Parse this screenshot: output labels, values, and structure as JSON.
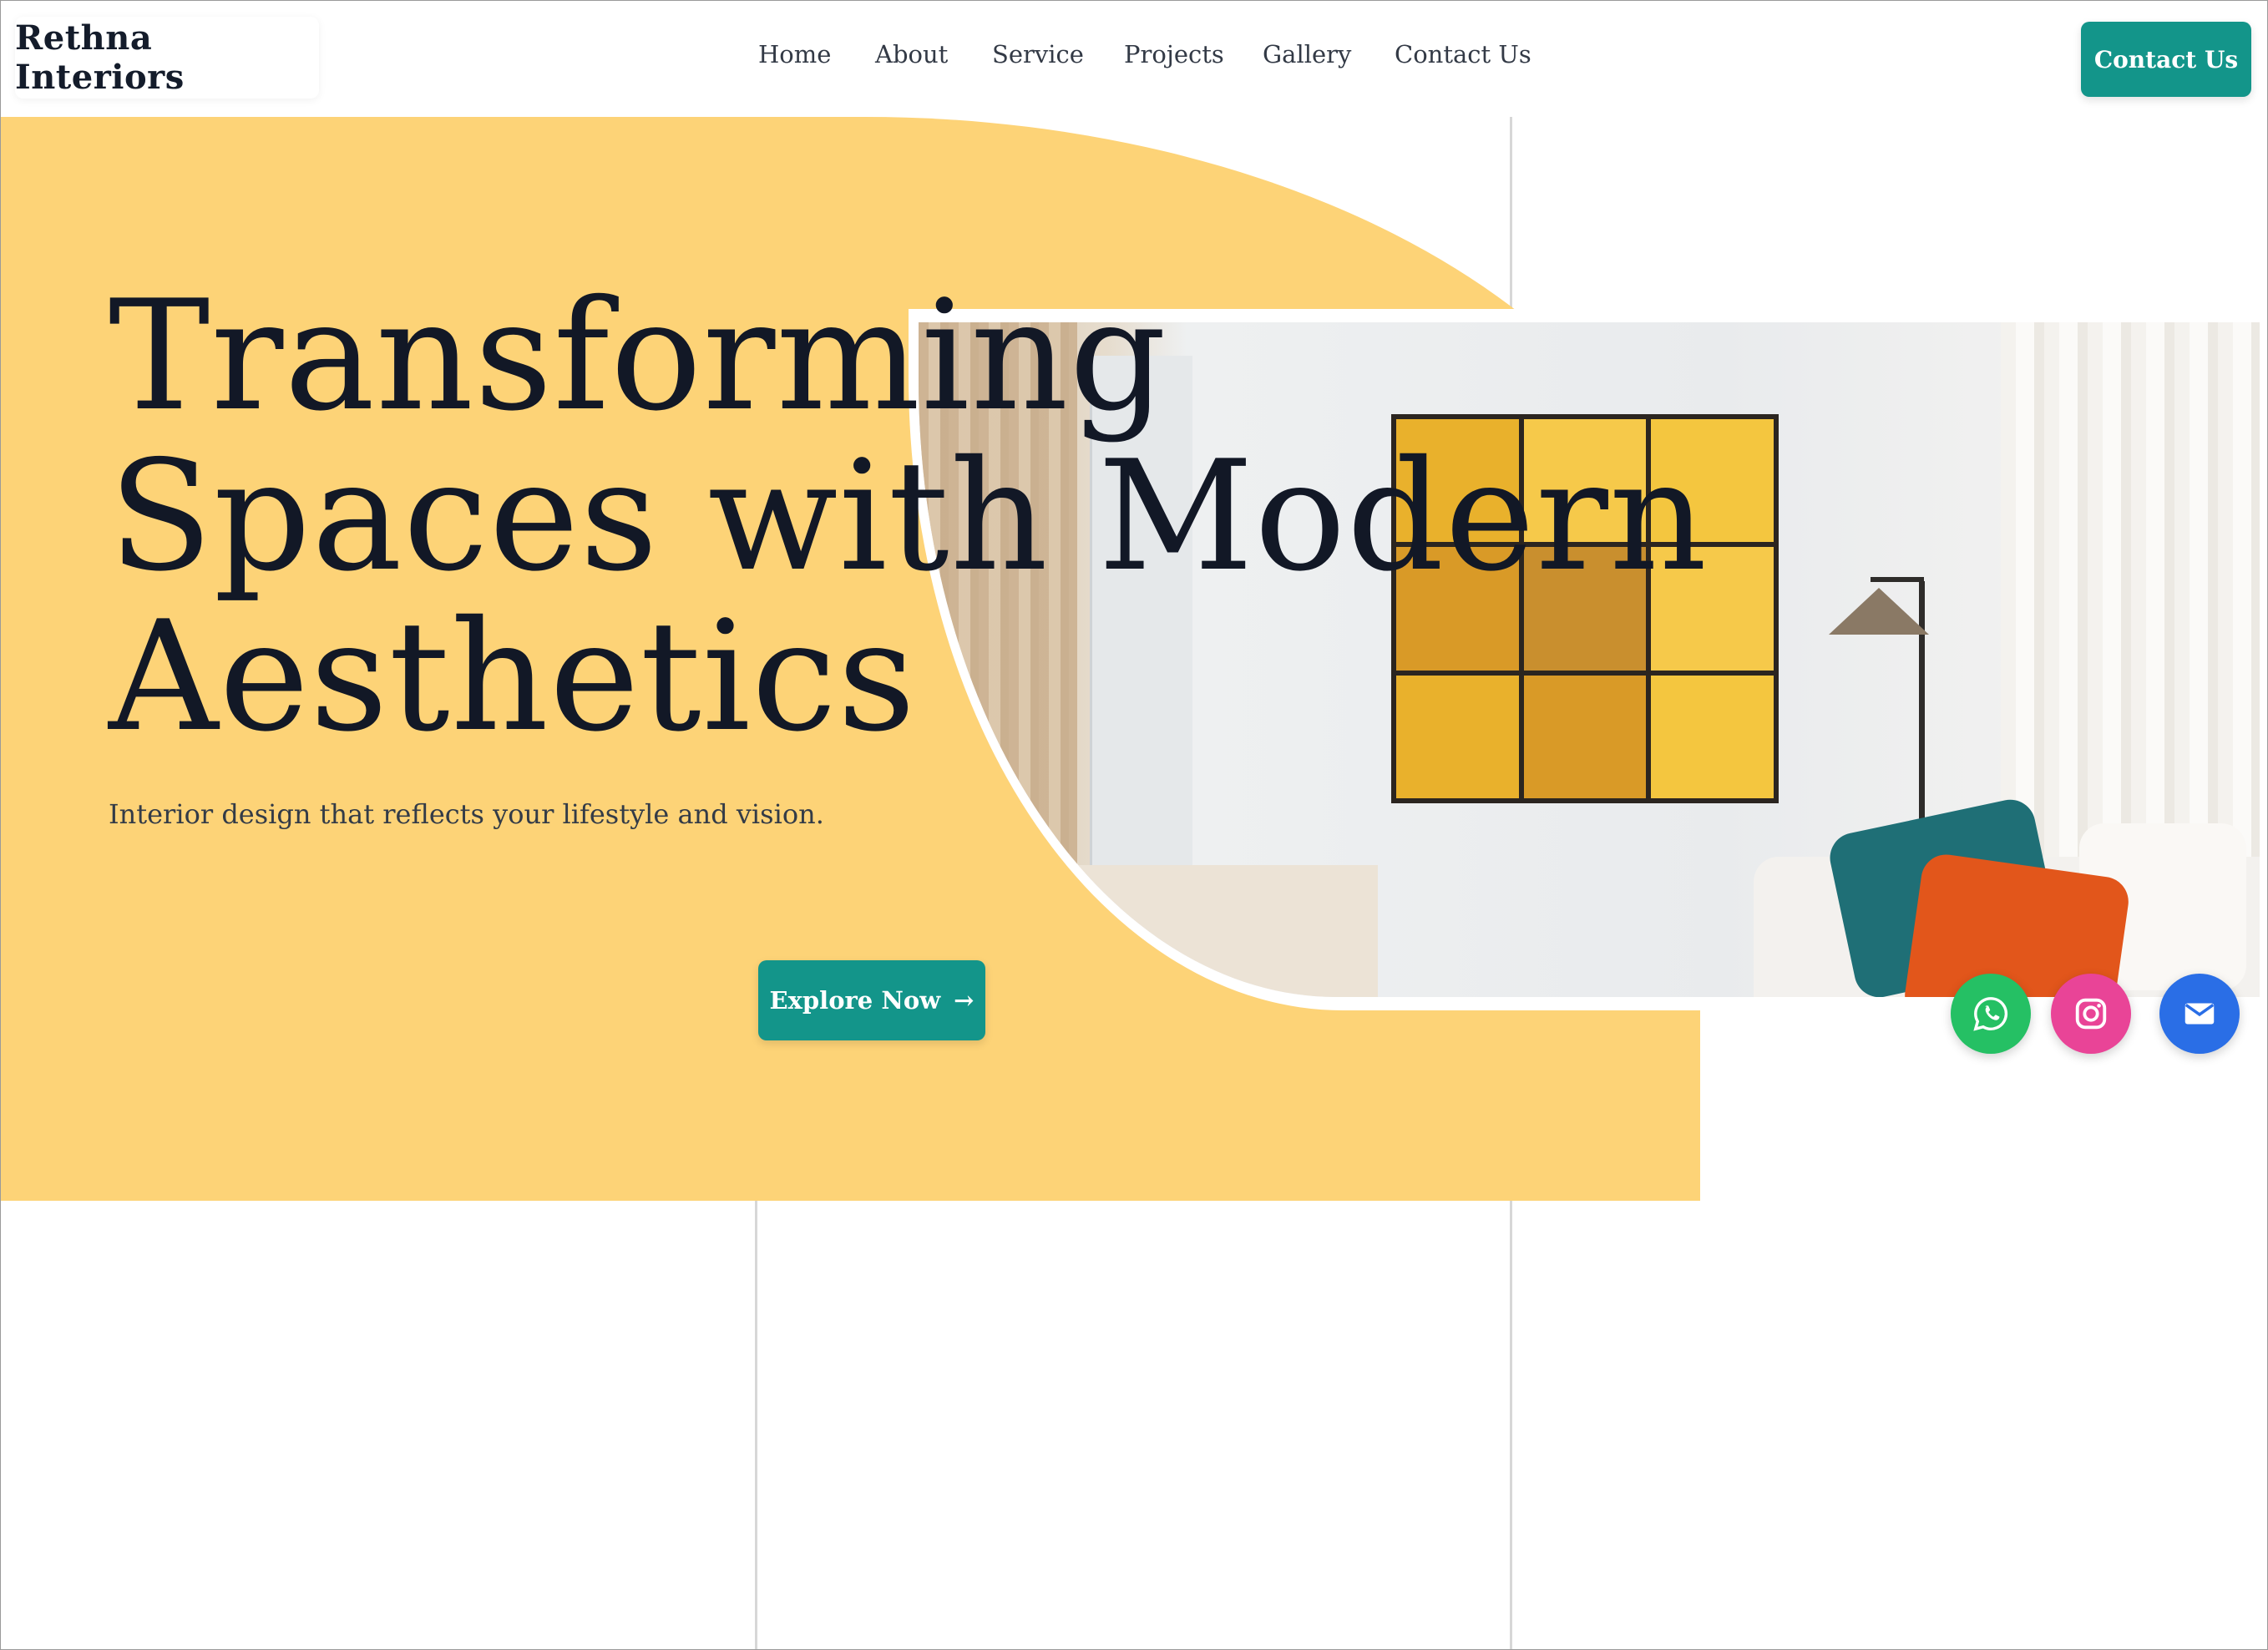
{
  "header": {
    "logo": "Rethna Interiors",
    "nav": [
      {
        "label": "Home"
      },
      {
        "label": "About"
      },
      {
        "label": "Service"
      },
      {
        "label": "Projects"
      },
      {
        "label": "Gallery"
      },
      {
        "label": "Contact Us"
      }
    ],
    "cta_label": "Contact Us"
  },
  "hero": {
    "title_lines": [
      "Transforming",
      "Spaces with Modern",
      "Aesthetics"
    ],
    "subtitle": "Interior design that reflects your lifestyle and vision.",
    "button_label": "Explore Now",
    "button_arrow": "→"
  },
  "social": [
    {
      "icon": "whatsapp-icon",
      "color": "#25c064"
    },
    {
      "icon": "instagram-icon",
      "color": "#e94497"
    },
    {
      "icon": "email-icon",
      "color": "#2a6ee6"
    }
  ],
  "colors": {
    "accent": "#13958a",
    "hero_background": "#fdd377",
    "text": "#121826"
  }
}
